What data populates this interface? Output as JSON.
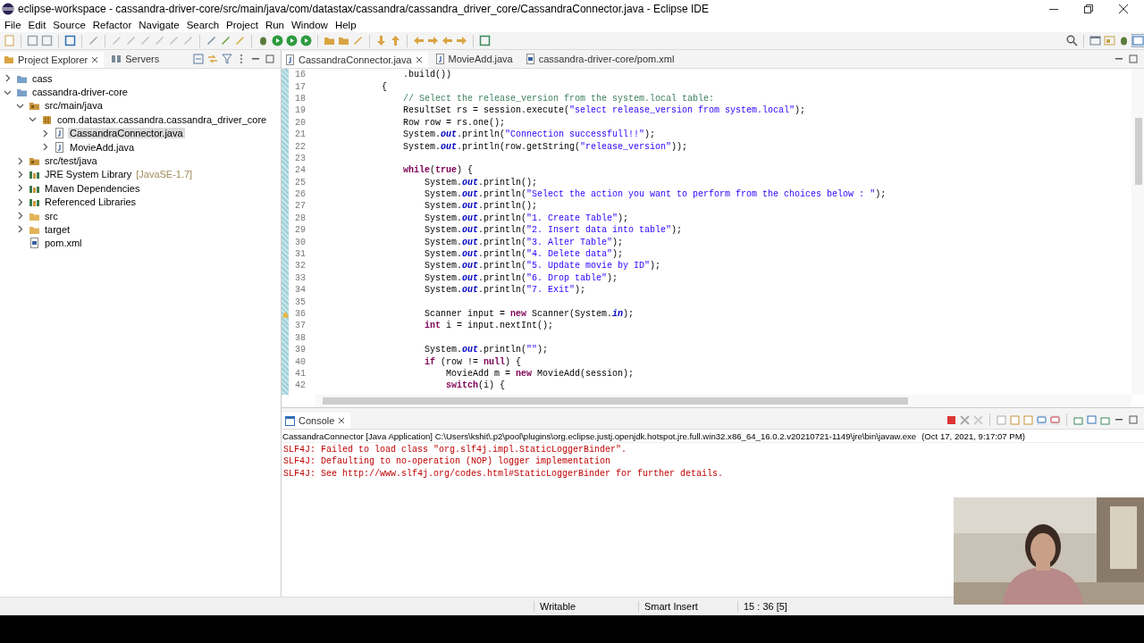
{
  "window": {
    "title": "eclipse-workspace - cassandra-driver-core/src/main/java/com/datastax/cassandra/cassandra_driver_core/CassandraConnector.java - Eclipse IDE"
  },
  "menu": [
    "File",
    "Edit",
    "Source",
    "Refactor",
    "Navigate",
    "Search",
    "Project",
    "Run",
    "Window",
    "Help"
  ],
  "project_explorer": {
    "tabs": [
      {
        "label": "Project Explorer",
        "selected": true
      },
      {
        "label": "Servers",
        "selected": false
      }
    ],
    "items": [
      {
        "label": "cass",
        "kind": "project",
        "expanded": false,
        "selected": false
      },
      {
        "label": "cassandra-driver-core",
        "kind": "project",
        "expanded": true,
        "selected": false,
        "children": [
          {
            "label": "src/main/java",
            "kind": "source-folder",
            "expanded": true,
            "selected": false,
            "children": [
              {
                "label": "com.datastax.cassandra.cassandra_driver_core",
                "kind": "package",
                "expanded": true,
                "selected": false,
                "children": [
                  {
                    "label": "CassandraConnector.java",
                    "kind": "java",
                    "expanded": false,
                    "selected": true
                  },
                  {
                    "label": "MovieAdd.java",
                    "kind": "java",
                    "expanded": false,
                    "selected": false
                  }
                ]
              }
            ]
          },
          {
            "label": "src/test/java",
            "kind": "source-folder",
            "expanded": false,
            "selected": false
          },
          {
            "label": "JRE System Library",
            "decoration": "[JavaSE-1.7]",
            "kind": "library",
            "expanded": false,
            "selected": false
          },
          {
            "label": "Maven Dependencies",
            "kind": "library",
            "expanded": false,
            "selected": false
          },
          {
            "label": "Referenced Libraries",
            "kind": "library",
            "expanded": false,
            "selected": false
          },
          {
            "label": "src",
            "kind": "folder",
            "expanded": false,
            "selected": false
          },
          {
            "label": "target",
            "kind": "folder",
            "expanded": false,
            "selected": false
          },
          {
            "label": "pom.xml",
            "kind": "xml",
            "selected": false
          }
        ]
      }
    ]
  },
  "editor": {
    "tabs": [
      {
        "label": "CassandraConnector.java",
        "kind": "java",
        "selected": true
      },
      {
        "label": "MovieAdd.java",
        "kind": "java",
        "selected": false
      },
      {
        "label": "cassandra-driver-core/pom.xml",
        "kind": "xml",
        "selected": false
      }
    ],
    "lines": [
      {
        "number": "16",
        "tokens": [
          {
            "text": "                .build())",
            "kind": "plain"
          }
        ]
      },
      {
        "number": "17",
        "tokens": [
          {
            "text": "            {",
            "kind": "plain"
          }
        ]
      },
      {
        "number": "18",
        "tokens": [
          {
            "text": "                // Select the release_version from the system.local table:",
            "kind": "comment"
          }
        ]
      },
      {
        "number": "19",
        "tokens": [
          {
            "text": "                ResultSet rs = session.execute(",
            "kind": "plain"
          },
          {
            "text": "\"select release_version from system.local\"",
            "kind": "string"
          },
          {
            "text": ");",
            "kind": "plain"
          }
        ]
      },
      {
        "number": "20",
        "tokens": [
          {
            "text": "                Row row = rs.one();",
            "kind": "plain"
          }
        ]
      },
      {
        "number": "21",
        "tokens": [
          {
            "text": "                System.",
            "kind": "plain"
          },
          {
            "text": "out",
            "kind": "field"
          },
          {
            "text": ".println(",
            "kind": "plain"
          },
          {
            "text": "\"Connection successfull!!\"",
            "kind": "string"
          },
          {
            "text": ");",
            "kind": "plain"
          }
        ]
      },
      {
        "number": "22",
        "tokens": [
          {
            "text": "                System.",
            "kind": "plain"
          },
          {
            "text": "out",
            "kind": "field"
          },
          {
            "text": ".println(row.getString(",
            "kind": "plain"
          },
          {
            "text": "\"release_version\"",
            "kind": "string"
          },
          {
            "text": "));",
            "kind": "plain"
          }
        ]
      },
      {
        "number": "23"
      },
      {
        "number": "24",
        "tokens": [
          {
            "text": "                while",
            "kind": "keyword"
          },
          {
            "text": "(",
            "kind": "plain"
          },
          {
            "text": "true",
            "kind": "keyword"
          },
          {
            "text": ") {",
            "kind": "plain"
          }
        ]
      },
      {
        "number": "25",
        "tokens": [
          {
            "text": "                    System.",
            "kind": "plain"
          },
          {
            "text": "out",
            "kind": "field"
          },
          {
            "text": ".println();",
            "kind": "plain"
          }
        ]
      },
      {
        "number": "26",
        "tokens": [
          {
            "text": "                    System.",
            "kind": "plain"
          },
          {
            "text": "out",
            "kind": "field"
          },
          {
            "text": ".println(",
            "kind": "plain"
          },
          {
            "text": "\"Select the action you want to perform from the choices below : \"",
            "kind": "string"
          },
          {
            "text": ");",
            "kind": "plain"
          }
        ]
      },
      {
        "number": "27",
        "tokens": [
          {
            "text": "                    System.",
            "kind": "plain"
          },
          {
            "text": "out",
            "kind": "field"
          },
          {
            "text": ".println();",
            "kind": "plain"
          }
        ]
      },
      {
        "number": "28",
        "tokens": [
          {
            "text": "                    System.",
            "kind": "plain"
          },
          {
            "text": "out",
            "kind": "field"
          },
          {
            "text": ".println(",
            "kind": "plain"
          },
          {
            "text": "\"1. Create Table\"",
            "kind": "string"
          },
          {
            "text": ");",
            "kind": "plain"
          }
        ]
      },
      {
        "number": "29",
        "tokens": [
          {
            "text": "                    System.",
            "kind": "plain"
          },
          {
            "text": "out",
            "kind": "field"
          },
          {
            "text": ".println(",
            "kind": "plain"
          },
          {
            "text": "\"2. Insert data into table\"",
            "kind": "string"
          },
          {
            "text": ");",
            "kind": "plain"
          }
        ]
      },
      {
        "number": "30",
        "tokens": [
          {
            "text": "                    System.",
            "kind": "plain"
          },
          {
            "text": "out",
            "kind": "field"
          },
          {
            "text": ".println(",
            "kind": "plain"
          },
          {
            "text": "\"3. Alter Table\"",
            "kind": "string"
          },
          {
            "text": ");",
            "kind": "plain"
          }
        ]
      },
      {
        "number": "31",
        "tokens": [
          {
            "text": "                    System.",
            "kind": "plain"
          },
          {
            "text": "out",
            "kind": "field"
          },
          {
            "text": ".println(",
            "kind": "plain"
          },
          {
            "text": "\"4. Delete data\"",
            "kind": "string"
          },
          {
            "text": ");",
            "kind": "plain"
          }
        ]
      },
      {
        "number": "32",
        "tokens": [
          {
            "text": "                    System.",
            "kind": "plain"
          },
          {
            "text": "out",
            "kind": "field"
          },
          {
            "text": ".println(",
            "kind": "plain"
          },
          {
            "text": "\"5. Update movie by ID\"",
            "kind": "string"
          },
          {
            "text": ");",
            "kind": "plain"
          }
        ]
      },
      {
        "number": "33",
        "tokens": [
          {
            "text": "                    System.",
            "kind": "plain"
          },
          {
            "text": "out",
            "kind": "field"
          },
          {
            "text": ".println(",
            "kind": "plain"
          },
          {
            "text": "\"6. Drop table\"",
            "kind": "string"
          },
          {
            "text": ");",
            "kind": "plain"
          }
        ]
      },
      {
        "number": "34",
        "tokens": [
          {
            "text": "                    System.",
            "kind": "plain"
          },
          {
            "text": "out",
            "kind": "field"
          },
          {
            "text": ".println(",
            "kind": "plain"
          },
          {
            "text": "\"7. Exit\"",
            "kind": "string"
          },
          {
            "text": ");",
            "kind": "plain"
          }
        ]
      },
      {
        "number": "35"
      },
      {
        "number": "36",
        "warning": true,
        "tokens": [
          {
            "text": "                    Scanner input = ",
            "kind": "plain"
          },
          {
            "text": "new",
            "kind": "keyword"
          },
          {
            "text": " Scanner(System.",
            "kind": "plain"
          },
          {
            "text": "in",
            "kind": "field"
          },
          {
            "text": ");",
            "kind": "plain"
          }
        ]
      },
      {
        "number": "37",
        "tokens": [
          {
            "text": "                    int",
            "kind": "keyword"
          },
          {
            "text": " i = input.nextInt();",
            "kind": "plain"
          }
        ]
      },
      {
        "number": "38"
      },
      {
        "number": "39",
        "tokens": [
          {
            "text": "                    System.",
            "kind": "plain"
          },
          {
            "text": "out",
            "kind": "field"
          },
          {
            "text": ".println(",
            "kind": "plain"
          },
          {
            "text": "\"\"",
            "kind": "string"
          },
          {
            "text": ");",
            "kind": "plain"
          }
        ]
      },
      {
        "number": "40",
        "tokens": [
          {
            "text": "                    if",
            "kind": "keyword"
          },
          {
            "text": " (row != ",
            "kind": "plain"
          },
          {
            "text": "null",
            "kind": "keyword"
          },
          {
            "text": ") {",
            "kind": "plain"
          }
        ]
      },
      {
        "number": "41",
        "tokens": [
          {
            "text": "                        MovieAdd m = ",
            "kind": "plain"
          },
          {
            "text": "new",
            "kind": "keyword"
          },
          {
            "text": " MovieAdd(session);",
            "kind": "plain"
          }
        ]
      },
      {
        "number": "42",
        "tokens": [
          {
            "text": "                        switch",
            "kind": "keyword"
          },
          {
            "text": "(i) {",
            "kind": "plain"
          }
        ]
      }
    ]
  },
  "console": {
    "tab": "Console",
    "launch": "CassandraConnector [Java Application] C:\\Users\\kshit\\.p2\\pool\\plugins\\org.eclipse.justj.openjdk.hotspot.jre.full.win32.x86_64_16.0.2.v20210721-1149\\jre\\bin\\javaw.exe",
    "timestamp": "(Oct 17, 2021, 9:17:07 PM)",
    "lines": [
      "SLF4J: Failed to load class \"org.slf4j.impl.StaticLoggerBinder\".",
      "SLF4J: Defaulting to no-operation (NOP) logger implementation",
      "SLF4J: See http://www.slf4j.org/codes.html#StaticLoggerBinder for further details."
    ]
  },
  "webcam": {
    "kind": "picture"
  },
  "status_bar": [
    "Writable",
    "Smart Insert",
    "15 : 36 [5]"
  ]
}
